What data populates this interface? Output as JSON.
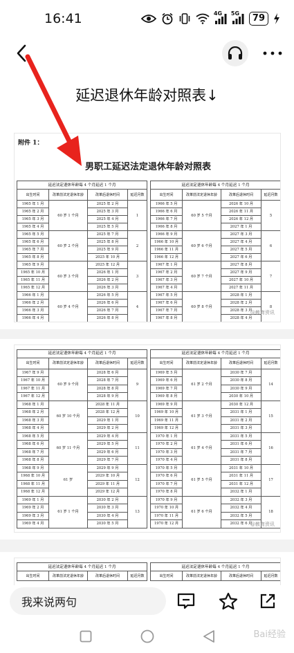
{
  "status": {
    "time": "16:41",
    "signal1": "4G",
    "signal2": "5G",
    "battery": "79"
  },
  "post": {
    "title": "延迟退休年龄对照表↓"
  },
  "doc": {
    "attachment": "附件 1：",
    "title": "男职工延迟法定退休年龄对照表",
    "header_main": "延迟法定退休年龄每 4 个月延迟 1 个月",
    "columns": [
      "出生时间",
      "改革前法定退休年龄",
      "改革后退休时间",
      "延迟月数"
    ],
    "watermark": "@教育资讯",
    "page1_left": [
      {
        "rows": [
          "1965 年 1 月",
          "1965 年 2 月",
          "1965 年 3 月",
          "1965 年 4 月"
        ],
        "age": "60 岁 1 个月",
        "times": [
          "2025 年 2 月",
          "2025 年 3 月",
          "2025 年 4 月",
          "2025 年 5 月"
        ],
        "delay": "1"
      },
      {
        "rows": [
          "1965 年 5 月",
          "1965 年 6 月",
          "1965 年 7 月",
          "1965 年 8 月"
        ],
        "age": "60 岁 2 个月",
        "times": [
          "2025 年 7 月",
          "2025 年 8 月",
          "2025 年 9 月",
          "2025 年 10 月"
        ],
        "delay": "2"
      },
      {
        "rows": [
          "1965 年 9 月",
          "1965 年 10 月",
          "1965 年 11 月",
          "1965 年 12 月"
        ],
        "age": "60 岁 3 个月",
        "times": [
          "2025 年 12 月",
          "2026 年 1 月",
          "2026 年 2 月",
          "2026 年 3 月"
        ],
        "delay": "3"
      },
      {
        "rows": [
          "1966 年 1 月",
          "1966 年 2 月",
          "1966 年 3 月",
          "1966 年 4 月"
        ],
        "age": "60 岁 4 个月",
        "times": [
          "2026 年 5 月",
          "2026 年 6 月",
          "2026 年 7 月",
          "2026 年 8 月"
        ],
        "delay": "4"
      }
    ],
    "page1_right": [
      {
        "rows": [
          "1966 年 5 月",
          "1966 年 6 月",
          "1966 年 7 月",
          "1966 年 8 月"
        ],
        "age": "60 岁 5 个月",
        "times": [
          "2026 年 10 月",
          "2026 年 11 月",
          "2026 年 12 月",
          "2027 年 1 月"
        ],
        "delay": "5"
      },
      {
        "rows": [
          "1966 年 9 月",
          "1966 年 10 月",
          "1966 年 11 月",
          "1966 年 12 月"
        ],
        "age": "60 岁 6 个月",
        "times": [
          "2027 年 3 月",
          "2027 年 4 月",
          "2027 年 5 月",
          "2027 年 6 月"
        ],
        "delay": "6"
      },
      {
        "rows": [
          "1967 年 1 月",
          "1967 年 2 月",
          "1967 年 3 月",
          "1967 年 4 月"
        ],
        "age": "60 岁 7 个月",
        "times": [
          "2027 年 8 月",
          "2027 年 9 月",
          "2027 年 10 月",
          "2027 年 11 月"
        ],
        "delay": "7"
      },
      {
        "rows": [
          "1967 年 5 月",
          "1967 年 6 月",
          "1967 年 7 月",
          "1967 年 8 月"
        ],
        "age": "60 岁 8 个月",
        "times": [
          "2028 年 1 月",
          "2028 年 2 月",
          "2028 年 3 月",
          "2028 年 4 月"
        ],
        "delay": "8"
      }
    ],
    "page2_left": [
      {
        "rows": [
          "1967 年 9 月",
          "1967 年 10 月",
          "1967 年 11 月",
          "1967 年 12 月"
        ],
        "age": "60 岁 9 个月",
        "times": [
          "2028 年 6 月",
          "2028 年 7 月",
          "2028 年 8 月",
          "2028 年 9 月"
        ],
        "delay": "9"
      },
      {
        "rows": [
          "1968 年 1 月",
          "1968 年 2 月",
          "1968 年 3 月",
          "1968 年 4 月"
        ],
        "age": "60 岁 10 个月",
        "times": [
          "2028 年 11 月",
          "2028 年 12 月",
          "2029 年 1 月",
          "2029 年 2 月"
        ],
        "delay": "10"
      },
      {
        "rows": [
          "1968 年 5 月",
          "1968 年 6 月",
          "1968 年 7 月",
          "1968 年 8 月"
        ],
        "age": "60 岁 11 个月",
        "times": [
          "2029 年 4 月",
          "2029 年 5 月",
          "2029 年 6 月",
          "2029 年 7 月"
        ],
        "delay": "11"
      },
      {
        "rows": [
          "1968 年 9 月",
          "1968 年 10 月",
          "1968 年 11 月",
          "1968 年 12 月"
        ],
        "age": "61 岁",
        "times": [
          "2029 年 9 月",
          "2029 年 10 月",
          "2029 年 11 月",
          "2029 年 12 月"
        ],
        "delay": "12"
      },
      {
        "rows": [
          "1969 年 1 月",
          "1969 年 2 月",
          "1969 年 3 月",
          "1969 年 4 月"
        ],
        "age": "61 岁 1 个月",
        "times": [
          "2030 年 2 月",
          "2030 年 3 月",
          "2030 年 4 月",
          "2030 年 5 月"
        ],
        "delay": "13"
      }
    ],
    "page2_right": [
      {
        "rows": [
          "1969 年 5 月",
          "1969 年 6 月",
          "1969 年 7 月",
          "1969 年 8 月"
        ],
        "age": "61 岁 2 个月",
        "times": [
          "2030 年 7 月",
          "2030 年 8 月",
          "2030 年 9 月",
          "2030 年 10 月"
        ],
        "delay": "14"
      },
      {
        "rows": [
          "1969 年 9 月",
          "1969 年 10 月",
          "1969 年 11 月",
          "1969 年 12 月"
        ],
        "age": "61 岁 3 个月",
        "times": [
          "2030 年 12 月",
          "2031 年 1 月",
          "2031 年 2 月",
          "2031 年 3 月"
        ],
        "delay": "15"
      },
      {
        "rows": [
          "1970 年 1 月",
          "1970 年 2 月",
          "1970 年 3 月",
          "1970 年 4 月"
        ],
        "age": "61 岁 4 个月",
        "times": [
          "2031 年 5 月",
          "2031 年 6 月",
          "2031 年 7 月",
          "2031 年 8 月"
        ],
        "delay": "16"
      },
      {
        "rows": [
          "1970 年 5 月",
          "1970 年 6 月",
          "1970 年 7 月",
          "1970 年 8 月"
        ],
        "age": "61 岁 5 个月",
        "times": [
          "2031 年 10 月",
          "2031 年 11 月",
          "2031 年 12 月",
          "2032 年 1 月"
        ],
        "delay": "17"
      },
      {
        "rows": [
          "1970 年 9 月",
          "1970 年 10 月",
          "1970 年 11 月",
          "1970 年 12 月"
        ],
        "age": "61 岁 6 个月",
        "times": [
          "2032 年 3 月",
          "2032 年 4 月",
          "2032 年 5 月",
          "2032 年 6 月"
        ],
        "delay": "18"
      }
    ]
  },
  "bottom": {
    "comment_placeholder": "我来说两句"
  },
  "sys": {
    "watermark": "Bai经验"
  },
  "accent": {
    "arrow": "#e8231d"
  }
}
